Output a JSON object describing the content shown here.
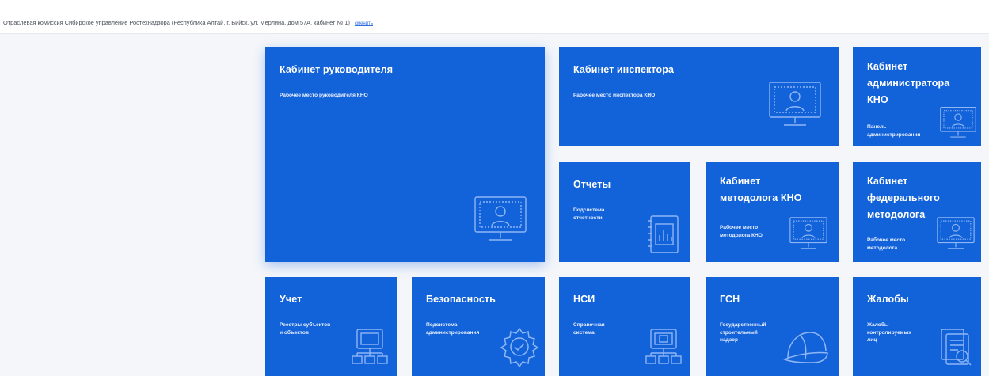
{
  "header": {
    "commission": "Отраслевая комиссия Сибирское управление Ростехнадзора (Республика Алтай, г. Бийск, ул. Мерлина, дом 57А, кабинет № 1)",
    "change_link": "сменить"
  },
  "colors": {
    "tile": "#1262d9",
    "page_bg": "#f4f6fa"
  },
  "tiles": [
    {
      "id": "head",
      "title": "Кабинет руководителя",
      "subtitle": "Рабочее место руководителя КНО",
      "icon": "monitor-person-icon"
    },
    {
      "id": "inspector",
      "title": "Кабинет инспектора",
      "subtitle": "Рабочее место инспектора КНО",
      "icon": "monitor-person-icon"
    },
    {
      "id": "admin",
      "title": "Кабинет\nадминистратора\nКНО",
      "subtitle": "Панель\nадминистрирования",
      "icon": "monitor-person-icon"
    },
    {
      "id": "reports",
      "title": "Отчеты",
      "subtitle": "Подсистема\nотчетности",
      "icon": "report-chart-icon"
    },
    {
      "id": "methodologist",
      "title": "Кабинет\nметодолога КНО",
      "subtitle": "Рабочее место\nметодолога КНО",
      "icon": "monitor-person-icon"
    },
    {
      "id": "federal",
      "title": "Кабинет\nфедерального\nметодолога",
      "subtitle": "Рабочее место\nметодолога",
      "icon": "monitor-person-icon"
    },
    {
      "id": "accounting",
      "title": "Учет",
      "subtitle": "Реестры субъектов\nи объектов",
      "icon": "registry-icon"
    },
    {
      "id": "security",
      "title": "Безопасность",
      "subtitle": "Подсистема\nадминистрирования",
      "icon": "gear-check-icon"
    },
    {
      "id": "nsi",
      "title": "НСИ",
      "subtitle": "Справочная\nсистема",
      "icon": "registry-icon"
    },
    {
      "id": "gsn",
      "title": "ГСН",
      "subtitle": "Государственный\nстроительный\nнадзор",
      "icon": "hard-hat-icon"
    },
    {
      "id": "complaints",
      "title": "Жалобы",
      "subtitle": "Жалобы\nконтролируемых\nлиц",
      "icon": "document-search-icon"
    }
  ]
}
